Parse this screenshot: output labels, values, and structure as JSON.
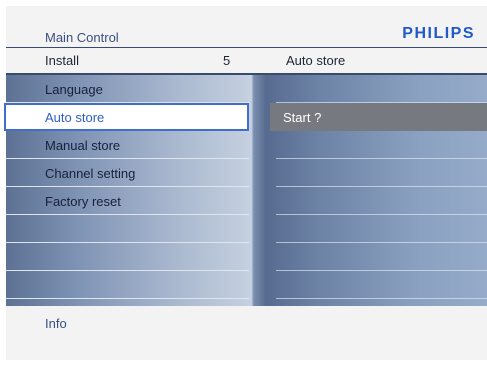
{
  "header": {
    "title": "Main Control",
    "brand": "PHILIPS"
  },
  "subheader": {
    "left": "Install",
    "count": "5",
    "right": "Auto store"
  },
  "left_menu": [
    {
      "label": "Language",
      "state": "normal"
    },
    {
      "label": "Auto store",
      "state": "active"
    },
    {
      "label": "Manual store",
      "state": "normal"
    },
    {
      "label": "Channel setting",
      "state": "normal"
    },
    {
      "label": "Factory reset",
      "state": "normal"
    },
    {
      "label": "",
      "state": "empty"
    },
    {
      "label": "",
      "state": "empty"
    },
    {
      "label": "",
      "state": "empty"
    }
  ],
  "right_menu": [
    {
      "label": "",
      "state": "empty"
    },
    {
      "label": "Start ?",
      "state": "selected"
    },
    {
      "label": "",
      "state": "empty"
    },
    {
      "label": "",
      "state": "empty"
    },
    {
      "label": "",
      "state": "empty"
    },
    {
      "label": "",
      "state": "empty"
    },
    {
      "label": "",
      "state": "empty"
    },
    {
      "label": "",
      "state": "empty"
    }
  ],
  "footer": {
    "info": "Info"
  },
  "colors": {
    "accent": "#2e5fc8",
    "selection": "#76797f",
    "brand": "#2159c8"
  }
}
